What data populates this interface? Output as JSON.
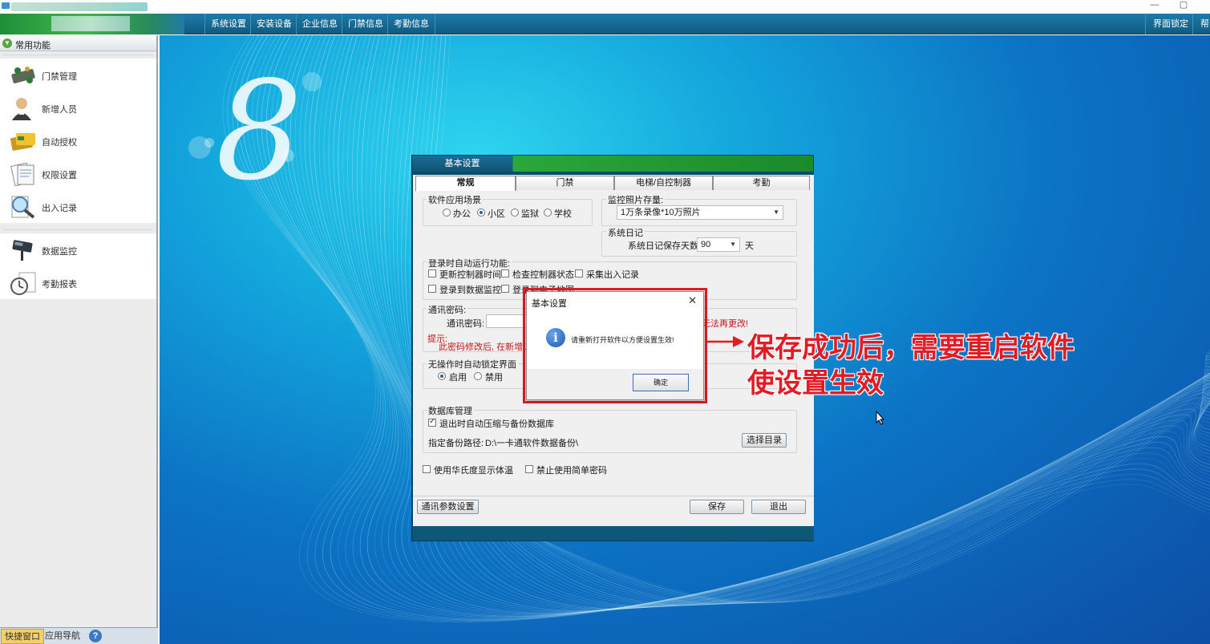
{
  "menubar": {
    "items": [
      "系统设置",
      "安装设备",
      "企业信息",
      "门禁信息",
      "考勤信息"
    ],
    "right": [
      "界面锁定",
      "帮"
    ]
  },
  "titlebar": {
    "minimize": "—",
    "restore": "▢"
  },
  "sidebar": {
    "header": "常用功能",
    "items": [
      {
        "label": "门禁管理",
        "icon": "door-access-icon"
      },
      {
        "label": "新增人员",
        "icon": "person-icon"
      },
      {
        "label": "自动授权",
        "icon": "card-icon"
      },
      {
        "label": "权限设置",
        "icon": "document-icon"
      },
      {
        "label": "出入记录",
        "icon": "magnifier-icon"
      }
    ],
    "items2": [
      {
        "label": "数据监控",
        "icon": "camera-icon"
      },
      {
        "label": "考勤报表",
        "icon": "clock-icon"
      }
    ],
    "bottom_tabs": [
      "快捷窗口",
      "应用导航"
    ]
  },
  "desktop": {
    "logo": "8"
  },
  "settings": {
    "title": "基本设置",
    "tabs": [
      "常规",
      "门禁",
      "电梯/自控制器",
      "考勤"
    ],
    "scene": {
      "label": "软件应用场景",
      "options": [
        "办公",
        "小区",
        "监狱",
        "学校"
      ],
      "selected": "小区"
    },
    "photo": {
      "label": "监控照片存量:",
      "value": "1万条录像*10万照片"
    },
    "log": {
      "label": "系统日记",
      "days_label": "系统日记保存天数:",
      "days_value": "90",
      "unit": "天"
    },
    "auto_run": {
      "label": "登录时自动运行功能:",
      "items": [
        {
          "label": "更新控制器时间",
          "checked": false
        },
        {
          "label": "检查控制器状态",
          "checked": false
        },
        {
          "label": "采集出入记录",
          "checked": false
        },
        {
          "label": "登录到数据监控",
          "checked": false
        },
        {
          "label": "登录到电子地图",
          "checked": false
        }
      ]
    },
    "comm": {
      "label": "通讯密码:",
      "field_label": "通讯密码:",
      "right_note": "无法再更改!",
      "tip_label": "提示:",
      "tip_text": "此密码修改后, 在新增设备"
    },
    "lock": {
      "label": "无操作时自动锁定界面",
      "options": [
        "启用",
        "禁用"
      ],
      "selected": "启用"
    },
    "db": {
      "label": "数据库管理",
      "auto_backup": "退出时自动压缩与备份数据库",
      "path_label": "指定备份路径:",
      "path_value": "D:\\一卡通软件数据备份\\",
      "browse": "选择目录"
    },
    "fahrenheit": "使用华氏度显示体温",
    "no_simple_pwd": "禁止使用简单密码",
    "buttons": {
      "comm_params": "通讯参数设置",
      "save": "保存",
      "exit": "退出"
    }
  },
  "dialog": {
    "title": "基本设置",
    "close": "✕",
    "icon": "info-icon",
    "message": "请重新打开软件以方便设置生效!",
    "ok": "确定"
  },
  "annotation": {
    "line1": "保存成功后，需要重启软件",
    "line2": "使设置生效"
  },
  "colors": {
    "accent_red": "#e21b24",
    "menubar": "#0f5b82",
    "brand_green": "#42b548"
  }
}
